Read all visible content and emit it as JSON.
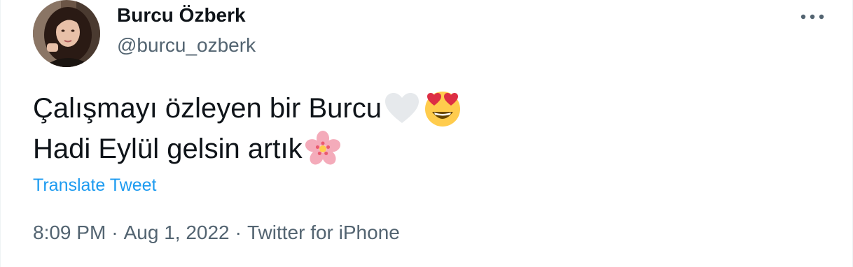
{
  "author": {
    "display_name": "Burcu Özberk",
    "handle": "@burcu_ozberk",
    "avatar_icon": "profile-photo"
  },
  "tweet": {
    "line1_text": "Çalışmayı özleyen bir Burcu",
    "line1_emojis": [
      "white-heart-icon",
      "heart-eyes-face-icon"
    ],
    "line2_text": "Hadi Eylül gelsin artık",
    "line2_emojis": [
      "cherry-blossom-icon"
    ],
    "translate_label": "Translate Tweet"
  },
  "meta": {
    "time": "8:09 PM",
    "separator": "·",
    "date": "Aug 1, 2022",
    "source": "Twitter for iPhone"
  },
  "menu": {
    "more_icon": "more-options-icon"
  },
  "colors": {
    "text_primary": "#0f1419",
    "text_secondary": "#536471",
    "link": "#1d9bf0"
  }
}
